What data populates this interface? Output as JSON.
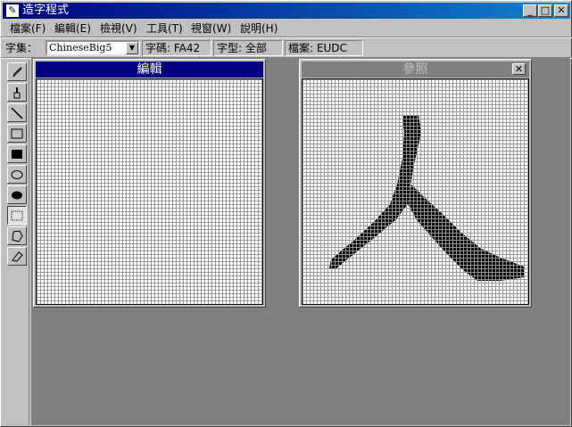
{
  "window": {
    "title": "造字程式"
  },
  "caption_buttons": {
    "minimize": "_",
    "maximize": "□",
    "close": "✕"
  },
  "menu": [
    "檔案(F)",
    "編輯(E)",
    "檢視(V)",
    "工具(T)",
    "視窗(W)",
    "說明(H)"
  ],
  "charset": {
    "label": "字集：",
    "value": "ChineseBig5"
  },
  "status": {
    "code": "字碼: FA42",
    "font": "字型: 全部",
    "file": "檔案: EUDC"
  },
  "tools": [
    "pencil-icon",
    "brush-icon",
    "line-icon",
    "rectangle-outline-icon",
    "rectangle-filled-icon",
    "ellipse-outline-icon",
    "ellipse-filled-icon",
    "rect-select-icon",
    "freeform-select-icon",
    "eraser-icon"
  ],
  "edit_window": {
    "title": "編輯"
  },
  "reference_window": {
    "title": "參照",
    "glyph": "人"
  },
  "colors": {
    "active_title": "#000080",
    "inactive_title": "#808080",
    "mdi_background": "#808080"
  }
}
